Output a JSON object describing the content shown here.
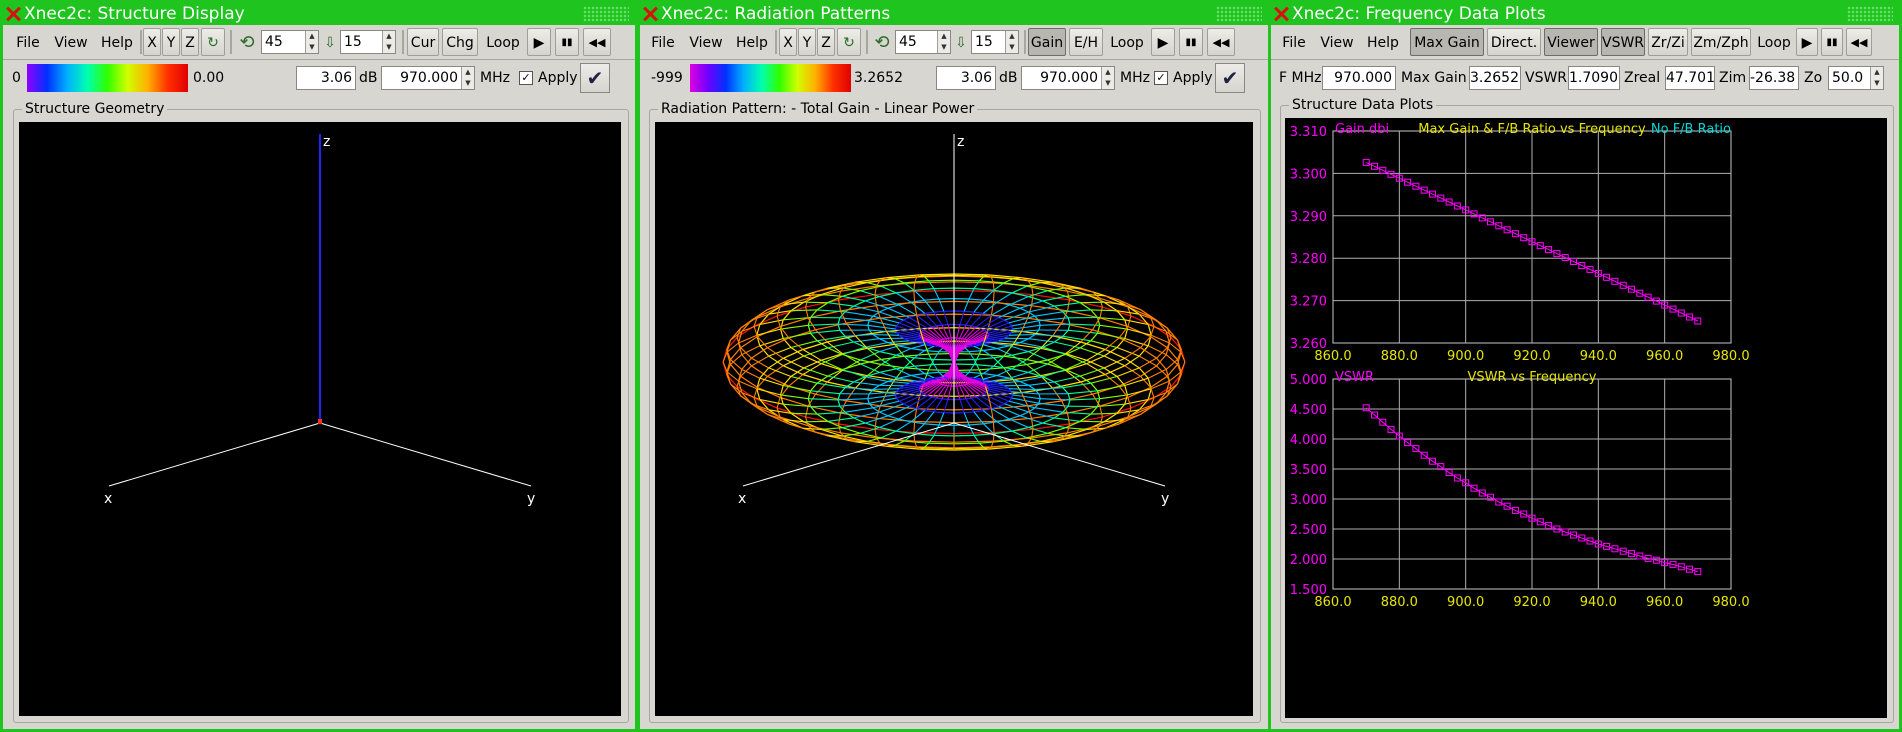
{
  "structure": {
    "title": "Xnec2c: Structure Display",
    "menu": [
      "File",
      "View",
      "Help"
    ],
    "axis_buttons": [
      "X",
      "Y",
      "Z"
    ],
    "rotate": "45",
    "incline": "15",
    "buttons": [
      "Cur",
      "Chg",
      "Loop"
    ],
    "scale_min": "0",
    "scale_max": "0.00",
    "db_value": "3.06",
    "db_label": "dB",
    "freq": "970.000",
    "freq_unit": "MHz",
    "apply_label": "Apply",
    "frame_label": "Structure Geometry",
    "axes": {
      "x": "x",
      "y": "y",
      "z": "z"
    }
  },
  "radiation": {
    "title": "Xnec2c: Radiation Patterns",
    "menu": [
      "File",
      "View",
      "Help"
    ],
    "axis_buttons": [
      "X",
      "Y",
      "Z"
    ],
    "rotate": "45",
    "incline": "15",
    "buttons": [
      "Gain",
      "E/H",
      "Loop"
    ],
    "scale_min": "-999",
    "scale_max": "3.2652",
    "db_value": "3.06",
    "db_label": "dB",
    "freq": "970.000",
    "freq_unit": "MHz",
    "apply_label": "Apply",
    "frame_label": "Radiation Pattern: - Total Gain - Linear Power",
    "axes": {
      "x": "x",
      "y": "y",
      "z": "z"
    }
  },
  "frequency": {
    "title": "Xnec2c: Frequency Data Plots",
    "menu": [
      "File",
      "View",
      "Help"
    ],
    "buttons": [
      "Max Gain",
      "Direct.",
      "Viewer",
      "VSWR",
      "Zr/Zi",
      "Zm/Zph",
      "Loop"
    ],
    "readouts": {
      "fmhz_label": "F MHz",
      "fmhz": "970.000",
      "maxgain_label": "Max Gain",
      "maxgain": "3.2652",
      "vswr_label": "VSWR",
      "vswr": "1.7090",
      "zreal_label": "Zreal",
      "zreal": "47.701",
      "zim_label": "Zim",
      "zim": "-26.38",
      "zo_label": "Zo",
      "zo": "50.0"
    },
    "frame_label": "Structure Data Plots"
  },
  "chart_data": [
    {
      "type": "scatter",
      "title": "Max Gain & F/B Ratio vs Frequency",
      "ylabel": "Gain dbi",
      "right_label": "No F/B Ratio",
      "xlim": [
        860,
        980
      ],
      "ylim": [
        3.26,
        3.31
      ],
      "x_ticks": [
        "860.0",
        "880.0",
        "900.0",
        "920.0",
        "940.0",
        "960.0",
        "980.0"
      ],
      "y_ticks": [
        "3.310",
        "3.300",
        "3.290",
        "3.280",
        "3.270",
        "3.260"
      ],
      "grid": true,
      "x_start": 870,
      "x_end": 970,
      "x_step": 2.5,
      "y_start": 3.3026,
      "y_end": 3.2652,
      "colors": {
        "points": "#ff00ff",
        "title": "#e6e600",
        "left": "#ff00ff",
        "right": "#00d8d8",
        "ticks": "#e6e600"
      }
    },
    {
      "type": "scatter",
      "title": "VSWR vs Frequency",
      "ylabel": "VSWR",
      "xlim": [
        860,
        980
      ],
      "ylim": [
        1.5,
        5.0
      ],
      "x_ticks": [
        "860.0",
        "880.0",
        "900.0",
        "920.0",
        "940.0",
        "960.0",
        "980.0"
      ],
      "y_ticks": [
        "5.000",
        "4.500",
        "4.000",
        "3.500",
        "3.000",
        "2.500",
        "2.000",
        "1.500"
      ],
      "grid": true,
      "x_start": 870,
      "x_end": 970,
      "x_step": 2.5,
      "y_points": [
        4.52,
        4.4,
        4.28,
        4.16,
        4.05,
        3.94,
        3.84,
        3.73,
        3.63,
        3.54,
        3.44,
        3.35,
        3.27,
        3.18,
        3.1,
        3.03,
        2.95,
        2.88,
        2.81,
        2.75,
        2.68,
        2.62,
        2.56,
        2.5,
        2.45,
        2.4,
        2.35,
        2.3,
        2.25,
        2.21,
        2.17,
        2.13,
        2.09,
        2.05,
        2.01,
        1.98,
        1.94,
        1.91,
        1.87,
        1.83,
        1.79
      ],
      "colors": {
        "points": "#ff00ff",
        "title": "#e6e600",
        "left": "#ff00ff",
        "ticks": "#e6e600"
      }
    }
  ]
}
